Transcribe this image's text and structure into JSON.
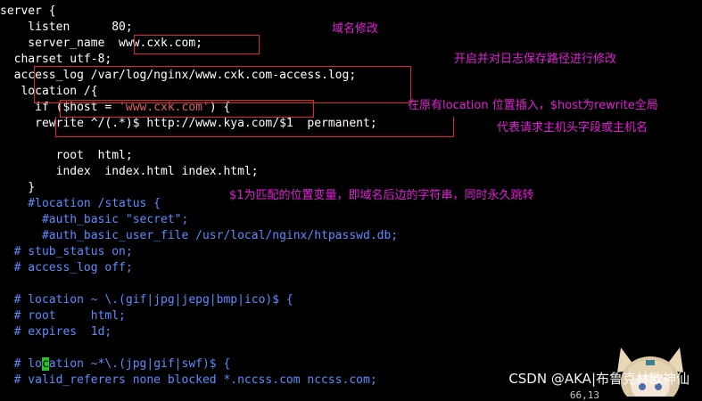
{
  "config_lines": [
    "server {",
    "    listen      80;",
    "    server_name  www.cxk.com;",
    "  charset utf-8;",
    "  access_log /var/log/nginx/www.cxk.com-access.log;",
    "   location /{",
    "     if ($host = 'www.cxk.com') {",
    "     rewrite ^/(.*)$ http://www.kya.com/$1  permanent;",
    "",
    "        root  html;",
    "        index  index.html index.html;",
    "    }",
    "    #location /status {",
    "      #auth_basic \"secret\";",
    "      #auth_basic_user_file /usr/local/nginx/htpasswd.db;",
    "  # stub_status on;",
    "  # access_log off;",
    "",
    "  # location ~ \\.(gif|jpg|jepg|bmp|ico)$ {",
    "  # root     html;",
    "  # expires  1d;",
    "",
    "  # location ~*\\.(jpg|gif|swf)$ {",
    "  # valid_referers none blocked *.nccss.com nccss.com;"
  ],
  "if_line": {
    "before": "     if ($host = ",
    "string": "'www.cxk.com'",
    "after": ") {"
  },
  "cursor_line": {
    "before": "  # lo",
    "cursor": "c",
    "after": "ation ~*\\.(jpg|gif|swf)$ {"
  },
  "annotations": {
    "domain_edit": "域名修改",
    "log_path": "开启并对日志保存路径进行修改",
    "location_insert": "在原有location 位置插入，$host为rewrite全局",
    "host_meaning": "代表请求主机头字段或主机名",
    "dollar1": "$1为匹配的位置变量，即域名后边的字符串，同时永久跳转"
  },
  "watermark": "CSDN @AKA|布鲁克林欧神仙",
  "status_bar": "66,13",
  "colors": {
    "annotation": "#e51bd9",
    "box": "#e0262b",
    "comment": "#5c8cff",
    "string": "#e06060",
    "cursor": "#22c322"
  }
}
